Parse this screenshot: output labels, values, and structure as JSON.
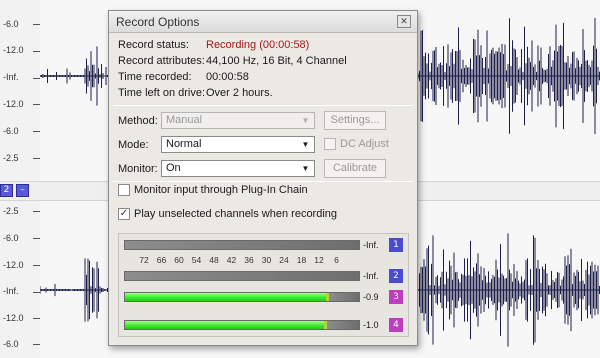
{
  "editor": {
    "ruler_top": [
      "-6.0",
      "-12.0",
      "-Inf.",
      "-12.0",
      "-6.0",
      "-2.5"
    ],
    "ruler_bottom": [
      "-2.5",
      "-6.0",
      "-12.0",
      "-Inf.",
      "-12.0",
      "-6.0"
    ],
    "channel_buttons": [
      "2",
      "–"
    ],
    "channel_button_color": "#5a5ad6"
  },
  "dialog": {
    "title": "Record Options",
    "close_glyph": "☒",
    "status": {
      "record_status_label": "Record status:",
      "record_status_value": "Recording (00:00:58)",
      "record_attributes_label": "Record attributes:",
      "record_attributes_value": "44,100 Hz, 16 Bit, 4 Channel",
      "time_recorded_label": "Time recorded:",
      "time_recorded_value": "00:00:58",
      "time_left_label": "Time left on drive:",
      "time_left_value": "Over 2 hours.",
      "recording_color": "#a01818"
    },
    "method": {
      "label": "Method:",
      "value": "Manual",
      "button": "Settings..."
    },
    "mode": {
      "label": "Mode:",
      "value": "Normal",
      "checkbox_label": "DC Adjust"
    },
    "monitor": {
      "label": "Monitor:",
      "value": "On",
      "button": "Calibrate"
    },
    "options": {
      "monitor_plugin_label": "Monitor input through Plug-In Chain",
      "monitor_plugin_checked": false,
      "play_unselected_label": "Play unselected channels when recording",
      "play_unselected_checked": true
    },
    "meters": {
      "scale": [
        "72",
        "66",
        "60",
        "54",
        "48",
        "42",
        "36",
        "30",
        "24",
        "18",
        "12",
        "6"
      ],
      "channels": [
        {
          "id": "1",
          "value": "-Inf.",
          "level": 0.0,
          "color": "#4b4bd0"
        },
        {
          "id": "2",
          "value": "-Inf.",
          "level": 0.0,
          "color": "#4b4bd0"
        },
        {
          "id": "3",
          "value": "-0.9",
          "level": 0.86,
          "color": "#c03cc0"
        },
        {
          "id": "4",
          "value": "-1.0",
          "level": 0.85,
          "color": "#c03cc0"
        }
      ]
    }
  }
}
